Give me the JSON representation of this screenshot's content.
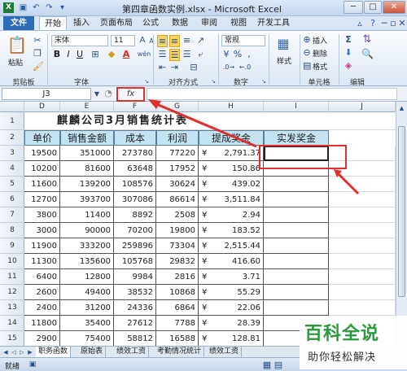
{
  "window": {
    "title": "第四章函数实例.xlsx - Microsoft Excel",
    "min_label": "─",
    "max_label": "□",
    "close_label": "✕"
  },
  "ribbon_tabs": [
    "文件",
    "开始",
    "插入",
    "页面布局",
    "公式",
    "数据",
    "审阅",
    "视图",
    "开发工具"
  ],
  "clipboard": {
    "paste_label": "粘贴",
    "group_label": "剪贴板"
  },
  "font": {
    "name": "宋体",
    "size": "11",
    "group_label": "字体",
    "bold": "B",
    "italic": "I",
    "underline": "U",
    "grow": "A",
    "shrink": "A",
    "font_color_glyph": "A",
    "phonetic": "wén"
  },
  "alignment": {
    "group_label": "对齐方式"
  },
  "number": {
    "format": "常规",
    "group_label": "数字",
    "percent": "%",
    "comma": ",",
    "currency": "¥"
  },
  "styles": {
    "label": "样式"
  },
  "cells": {
    "insert": "插入",
    "delete": "删除",
    "format": "格式",
    "group_label": "单元格"
  },
  "editing": {
    "group_label": "编辑",
    "sum_glyph": "Σ"
  },
  "formula_bar": {
    "name_box": "J3",
    "fx": "fx",
    "formula": ""
  },
  "columns": [
    "D",
    "E",
    "F",
    "G",
    "H",
    "I",
    "J",
    "K"
  ],
  "rows": [
    "1",
    "2",
    "3",
    "4",
    "5",
    "6",
    "7",
    "8",
    "9",
    "10",
    "11",
    "12",
    "13",
    "14",
    "15"
  ],
  "sheet": {
    "title": "麒麟公司3月销售统计表",
    "headers": [
      "单价",
      "销售金额",
      "成本",
      "利润",
      "提成奖金",
      "实发奖金"
    ],
    "data": [
      [
        "19500",
        "351000",
        "273780",
        "77220",
        "¥",
        "2,791.37"
      ],
      [
        "10200",
        "81600",
        "63648",
        "17952",
        "¥",
        "150.86"
      ],
      [
        "11600",
        "139200",
        "108576",
        "30624",
        "¥",
        "439.02"
      ],
      [
        "12700",
        "393700",
        "307086",
        "86614",
        "¥",
        "3,511.84"
      ],
      [
        "3800",
        "11400",
        "8892",
        "2508",
        "¥",
        "2.94"
      ],
      [
        "3000",
        "90000",
        "70200",
        "19800",
        "¥",
        "183.52"
      ],
      [
        "11900",
        "333200",
        "259896",
        "73304",
        "¥",
        "2,515.44"
      ],
      [
        "11300",
        "135600",
        "105768",
        "29832",
        "¥",
        "416.60"
      ],
      [
        "6400",
        "12800",
        "9984",
        "2816",
        "¥",
        "3.71"
      ],
      [
        "2600",
        "49400",
        "38532",
        "10868",
        "¥",
        "55.29"
      ],
      [
        "2400",
        "31200",
        "24336",
        "6864",
        "¥",
        "22.06"
      ],
      [
        "11800",
        "35400",
        "27612",
        "7788",
        "¥",
        "28.39"
      ],
      [
        "2900",
        "75400",
        "58812",
        "16588",
        "¥",
        "128.81"
      ]
    ]
  },
  "sheet_tabs": [
    "职务函数",
    "原始表",
    "绩效工资",
    "考勤情况统计",
    "绩效工资"
  ],
  "status": {
    "ready": "就绪"
  },
  "watermark": {
    "main": "百科全说",
    "sub": "助你轻松解决"
  },
  "colors": {
    "header_fill": "#c4e4f3",
    "annotation": "#e0302e",
    "file_tab": "#2e6cb8",
    "watermark_green": "#2a9a3c"
  }
}
